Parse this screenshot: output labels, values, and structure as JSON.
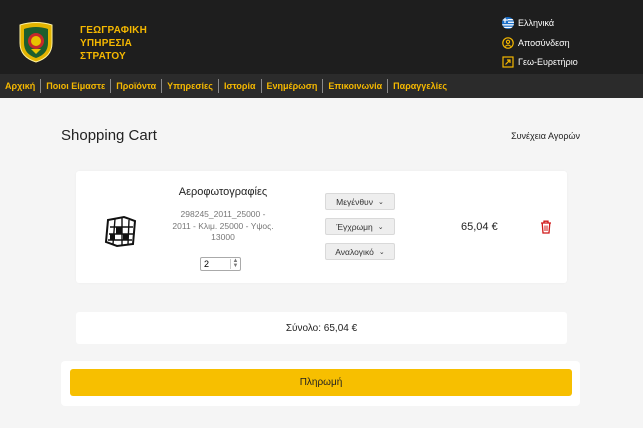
{
  "header": {
    "brand_lines": [
      "ΓΕΩΓΡΑΦΙΚΗ",
      "ΥΠΗΡΕΣΙΑ",
      "ΣΤΡΑΤΟΥ"
    ],
    "language": "Ελληνικά",
    "logout": "Αποσύνδεση",
    "geo_index": "Γεω-Ευρετήριο",
    "accent": "#f5b800"
  },
  "nav": {
    "items": [
      "Αρχική",
      "Ποιοι Είμαστε",
      "Προϊόντα",
      "Υπηρεσίες",
      "Ιστορία",
      "Ενημέρωση",
      "Επικοινωνία",
      "Παραγγελίες"
    ]
  },
  "page": {
    "title": "Shopping Cart",
    "continue_shopping": "Συνέχεια Αγορών"
  },
  "cart": {
    "item": {
      "name": "Αεροφωτογραφίες",
      "desc_lines": [
        "298245_2011_25000 -",
        "2011 - Κλιμ. 25000 - Υψος.",
        "13000"
      ],
      "quantity": "2",
      "options": [
        "Μεγένθυν",
        "Έγχρωμη",
        "Αναλογικό"
      ],
      "price": "65,04 €"
    },
    "total": "Σύνολο: 65,04 €",
    "pay_button": "Πληρωμή"
  }
}
